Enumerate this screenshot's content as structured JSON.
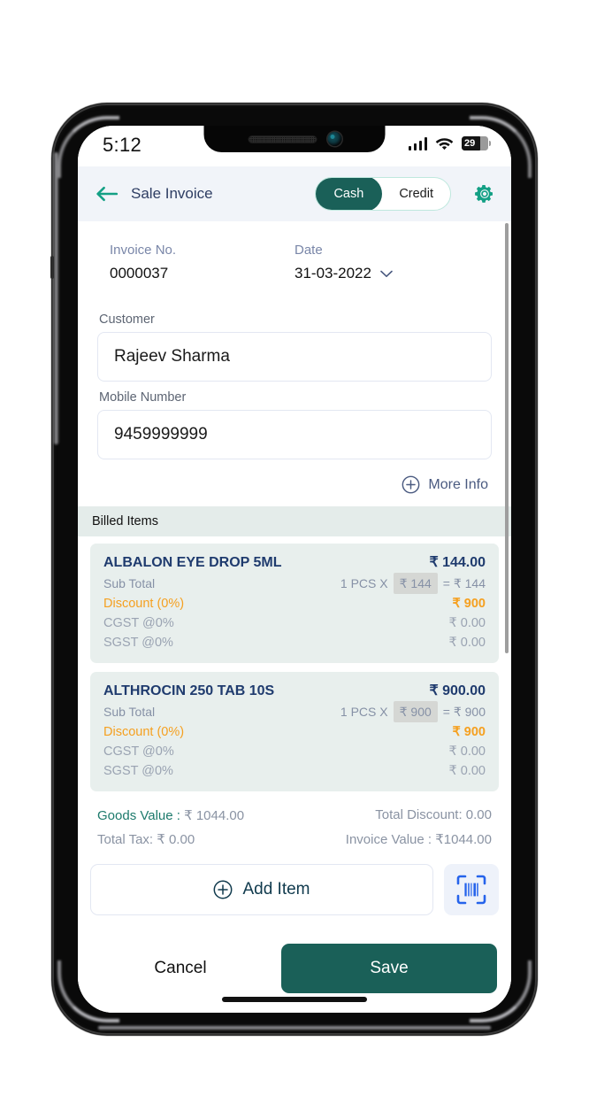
{
  "status_bar": {
    "time": "5:12",
    "signal_icon": "cellular-signal-icon",
    "wifi_icon": "wifi-icon",
    "battery_percent": "29"
  },
  "app_bar": {
    "back_icon": "back-arrow-icon",
    "title": "Sale Invoice",
    "payment_modes": [
      {
        "label": "Cash",
        "active": true
      },
      {
        "label": "Credit",
        "active": false
      }
    ],
    "settings_icon": "gear-icon",
    "accent_color": "#1a6058"
  },
  "invoice_meta": {
    "invoice_no_label": "Invoice No.",
    "invoice_no_value": "0000037",
    "date_label": "Date",
    "date_value": "31-03-2022",
    "date_chevron_icon": "chevron-down-icon"
  },
  "customer": {
    "name_label": "Customer",
    "name_value": "Rajeev Sharma",
    "name_placeholder": "Customer",
    "mobile_label": "Mobile Number",
    "mobile_value": "9459999999",
    "mobile_placeholder": "Mobile Number",
    "more_info_label": "More Info",
    "more_info_icon": "plus-circle-icon"
  },
  "billed_items": {
    "section_title": "Billed Items",
    "items": [
      {
        "name": "ALBALON EYE DROP 5ML",
        "amount": "₹ 144.00",
        "sub_total_label": "Sub Total",
        "qty": "1 PCS X",
        "rate": "₹ 144",
        "line_total": "= ₹ 144",
        "discount_label": "Discount (0%)",
        "discount_value": "₹ 900",
        "cgst_label": "CGST @0%",
        "cgst_value": "₹ 0.00",
        "sgst_label": "SGST @0%",
        "sgst_value": "₹ 0.00"
      },
      {
        "name": "ALTHROCIN 250 TAB 10S",
        "amount": "₹ 900.00",
        "sub_total_label": "Sub Total",
        "qty": "1 PCS X",
        "rate": "₹ 900",
        "line_total": "= ₹ 900",
        "discount_label": "Discount (0%)",
        "discount_value": "₹ 900",
        "cgst_label": "CGST @0%",
        "cgst_value": "₹ 0.00",
        "sgst_label": "SGST @0%",
        "sgst_value": "₹ 0.00"
      }
    ]
  },
  "totals": {
    "goods_value_label": "Goods Value :",
    "goods_value": "₹ 1044.00",
    "total_discount": "Total Discount: 0.00",
    "total_tax": "Total Tax: ₹ 0.00",
    "invoice_value": "Invoice Value : ₹1044.00"
  },
  "actions": {
    "add_item_label": "Add Item",
    "add_item_icon": "plus-circle-icon",
    "scan_icon": "barcode-scan-icon",
    "cancel_label": "Cancel",
    "save_label": "Save"
  }
}
